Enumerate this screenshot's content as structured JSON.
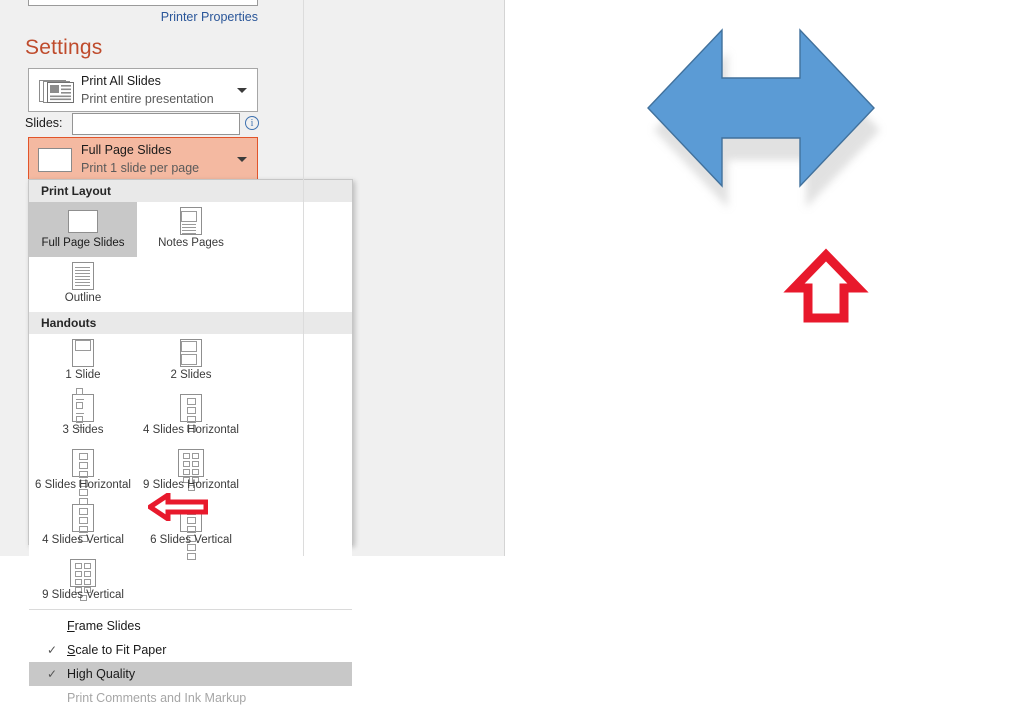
{
  "panel": {
    "printer_properties": "Printer Properties",
    "settings_title": "Settings",
    "print_range": {
      "title": "Print All Slides",
      "subtitle": "Print entire presentation",
      "icon": "slides-stack-icon",
      "caret": "chevron-down-icon"
    },
    "slides_row": {
      "label": "Slides:",
      "value": "",
      "placeholder": "",
      "info_icon": "info-icon",
      "info_glyph": "i"
    },
    "print_layout_combo": {
      "title": "Full Page Slides",
      "subtitle": "Print 1 slide per page",
      "icon": "blank-slide-icon",
      "caret": "chevron-down-icon",
      "fill_color": "#F4B9A1",
      "border_color": "#E2542A"
    }
  },
  "menu": {
    "sections": [
      {
        "header": "Print Layout",
        "items": [
          {
            "label": "Full Page Slides",
            "icon": "full-page-slide-icon",
            "selected": true
          },
          {
            "label": "Notes Pages",
            "icon": "notes-page-icon",
            "selected": false
          },
          {
            "label": "Outline",
            "icon": "outline-icon",
            "selected": false
          }
        ]
      },
      {
        "header": "Handouts",
        "items": [
          {
            "label": "1 Slide",
            "icon": "handout-1-slide-icon",
            "selected": false
          },
          {
            "label": "2 Slides",
            "icon": "handout-2-slides-icon",
            "selected": false
          },
          {
            "label": "3 Slides",
            "icon": "handout-3-slides-icon",
            "selected": false
          },
          {
            "label": "4 Slides Horizontal",
            "icon": "handout-4-horizontal-icon",
            "selected": false
          },
          {
            "label": "6 Slides Horizontal",
            "icon": "handout-6-horizontal-icon",
            "selected": false
          },
          {
            "label": "9 Slides Horizontal",
            "icon": "handout-9-horizontal-icon",
            "selected": false
          },
          {
            "label": "4 Slides Vertical",
            "icon": "handout-4-vertical-icon",
            "selected": false
          },
          {
            "label": "6 Slides Vertical",
            "icon": "handout-6-vertical-icon",
            "selected": false
          },
          {
            "label": "9 Slides Vertical",
            "icon": "handout-9-vertical-icon",
            "selected": false
          }
        ]
      }
    ],
    "options": [
      {
        "label": "Frame Slides",
        "accel": "F",
        "checked": false,
        "highlighted": false,
        "disabled": false
      },
      {
        "label": "Scale to Fit Paper",
        "accel": "S",
        "checked": true,
        "highlighted": false,
        "disabled": false
      },
      {
        "label": "High Quality",
        "accel": "",
        "checked": true,
        "highlighted": true,
        "disabled": false
      },
      {
        "label": "Print Comments and Ink Markup",
        "accel": "",
        "checked": false,
        "highlighted": false,
        "disabled": true
      }
    ],
    "check_glyph": "✓"
  },
  "artwork": {
    "shape": "left-right-double-arrow",
    "fill_color": "#5B9BD5",
    "outline_color": "#41719C",
    "shadow_color": "#C9C9C9",
    "annotation_up_arrow": {
      "name": "red-up-arrow-annotation",
      "color": "#E8192C"
    },
    "annotation_left_arrow": {
      "name": "red-left-arrow-annotation",
      "color": "#E8192C"
    }
  }
}
